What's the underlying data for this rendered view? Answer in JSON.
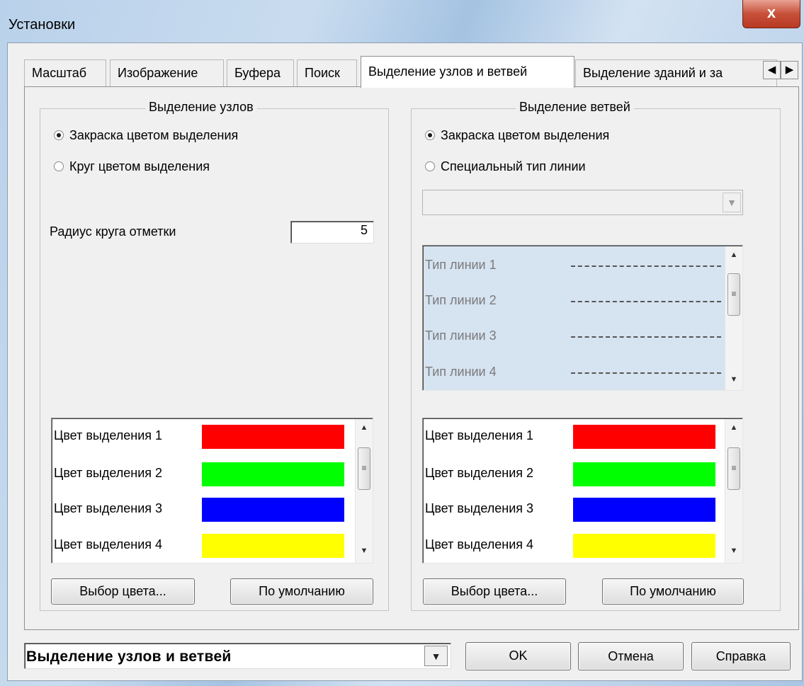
{
  "window": {
    "title": "Установки",
    "close_label": "x"
  },
  "tabs": [
    {
      "label": "Масштаб",
      "active": false
    },
    {
      "label": "Изображение",
      "active": false
    },
    {
      "label": "Буфера",
      "active": false
    },
    {
      "label": "Поиск",
      "active": false
    },
    {
      "label": "Выделение узлов и ветвей",
      "active": true
    },
    {
      "label": "Выделение зданий и за",
      "active": false
    }
  ],
  "tab_scroll": {
    "left": "◀",
    "right": "▶"
  },
  "nodes": {
    "title": "Выделение узлов",
    "radio_fill": {
      "label": "Закраска цветом выделения",
      "checked": true
    },
    "radio_circle": {
      "label": "Круг цветом выделения",
      "checked": false
    },
    "radius_label": "Радиус круга отметки",
    "radius_value": "5",
    "colors": [
      {
        "label": "Цвет выделения 1",
        "color": "#ff0000"
      },
      {
        "label": "Цвет выделения 2",
        "color": "#00ff00"
      },
      {
        "label": "Цвет выделения 3",
        "color": "#0000ff"
      },
      {
        "label": "Цвет выделения 4",
        "color": "#ffff00"
      }
    ],
    "choose_color_label": "Выбор цвета...",
    "default_label": "По умолчанию"
  },
  "branches": {
    "title": "Выделение ветвей",
    "radio_fill": {
      "label": "Закраска цветом выделения",
      "checked": true
    },
    "radio_line": {
      "label": "Специальный тип линии",
      "checked": false
    },
    "line_select_value": "",
    "line_types": [
      {
        "label": "Тип линии 1"
      },
      {
        "label": "Тип линии 2"
      },
      {
        "label": "Тип линии 3"
      },
      {
        "label": "Тип линии 4"
      }
    ],
    "colors": [
      {
        "label": "Цвет выделения 1",
        "color": "#ff0000"
      },
      {
        "label": "Цвет выделения 2",
        "color": "#00ff00"
      },
      {
        "label": "Цвет выделения 3",
        "color": "#0000ff"
      },
      {
        "label": "Цвет выделения 4",
        "color": "#ffff00"
      }
    ],
    "choose_color_label": "Выбор цвета...",
    "default_label": "По умолчанию"
  },
  "footer": {
    "page_select_value": "Выделение узлов и ветвей",
    "ok_label": "OK",
    "cancel_label": "Отмена",
    "help_label": "Справка"
  }
}
